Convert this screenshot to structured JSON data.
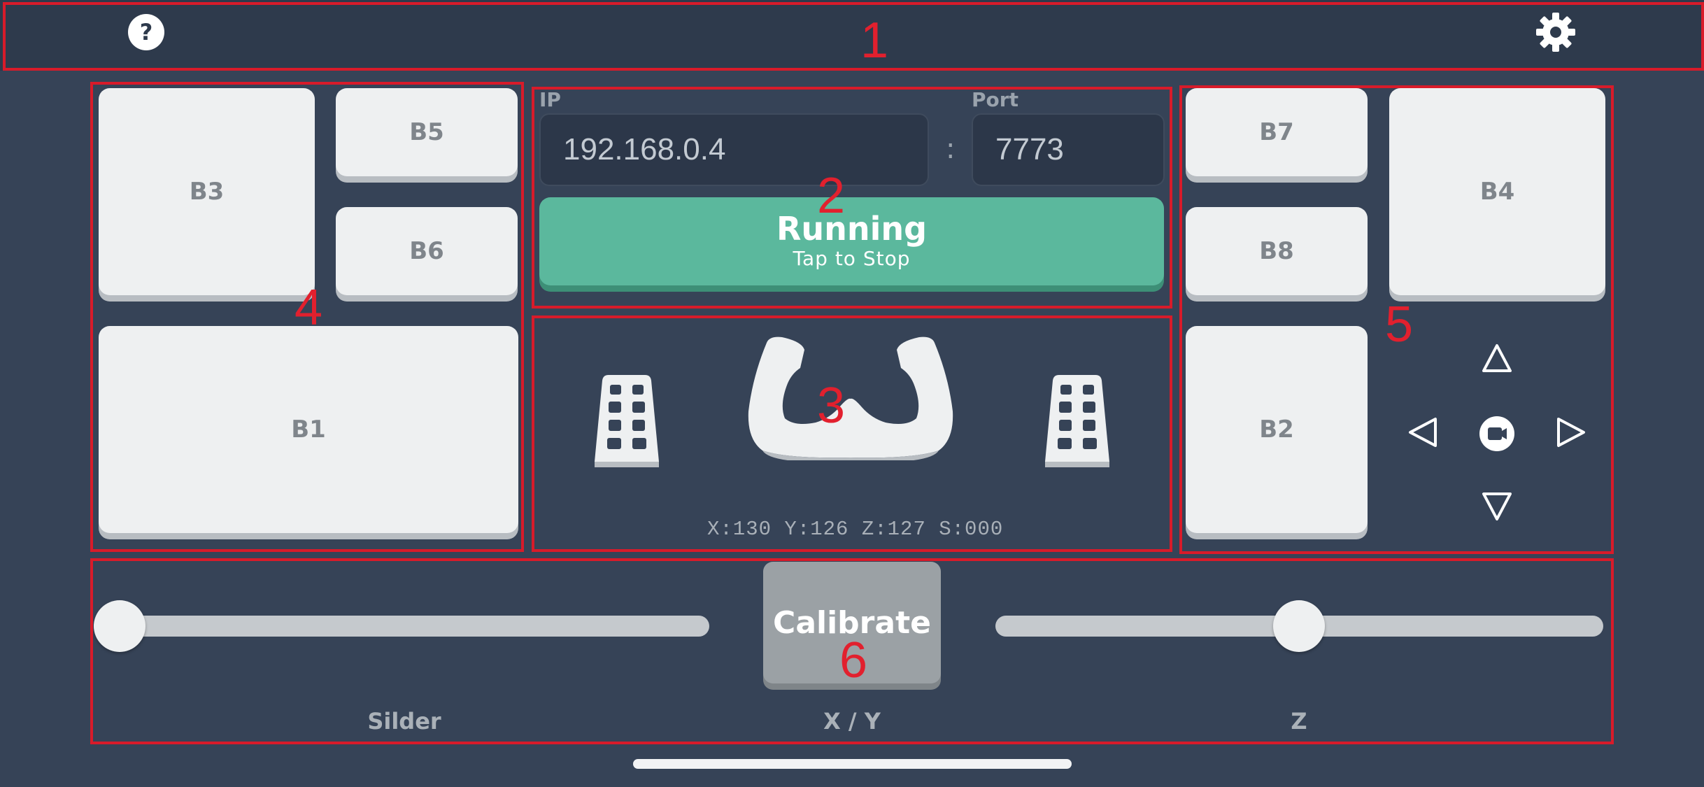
{
  "header": {
    "help_icon": "question-circle-icon",
    "settings_icon": "gear-icon"
  },
  "annotations": [
    "1",
    "2",
    "3",
    "4",
    "5",
    "6"
  ],
  "connection": {
    "ip_label": "IP",
    "ip_value": "192.168.0.4",
    "separator": ":",
    "port_label": "Port",
    "port_value": "7773",
    "status": "Running",
    "status_hint": "Tap to Stop",
    "status_color": "#5bb89d"
  },
  "controls": {
    "left_pedal_icon": "pedal-icon",
    "yoke_icon": "yoke-icon",
    "right_pedal_icon": "pedal-icon",
    "readout": "X:130 Y:126 Z:127 S:000"
  },
  "left_buttons": {
    "b3": "B3",
    "b5": "B5",
    "b6": "B6",
    "b1": "B1"
  },
  "right_buttons": {
    "b7": "B7",
    "b8": "B8",
    "b4": "B4",
    "b2": "B2"
  },
  "dpad": {
    "up_icon": "triangle-up-icon",
    "down_icon": "triangle-down-icon",
    "left_icon": "triangle-left-icon",
    "right_icon": "triangle-right-icon",
    "center_icon": "camera-icon"
  },
  "bottom": {
    "calibrate_label": "Calibrate",
    "slider_label": "Silder",
    "xy_label": "X / Y",
    "z_label": "Z",
    "slider_level": 0.0,
    "z_level": 0.5
  },
  "colors": {
    "background": "#364357",
    "topbar": "#2e3a4c",
    "annotation": "#d81b2a"
  }
}
